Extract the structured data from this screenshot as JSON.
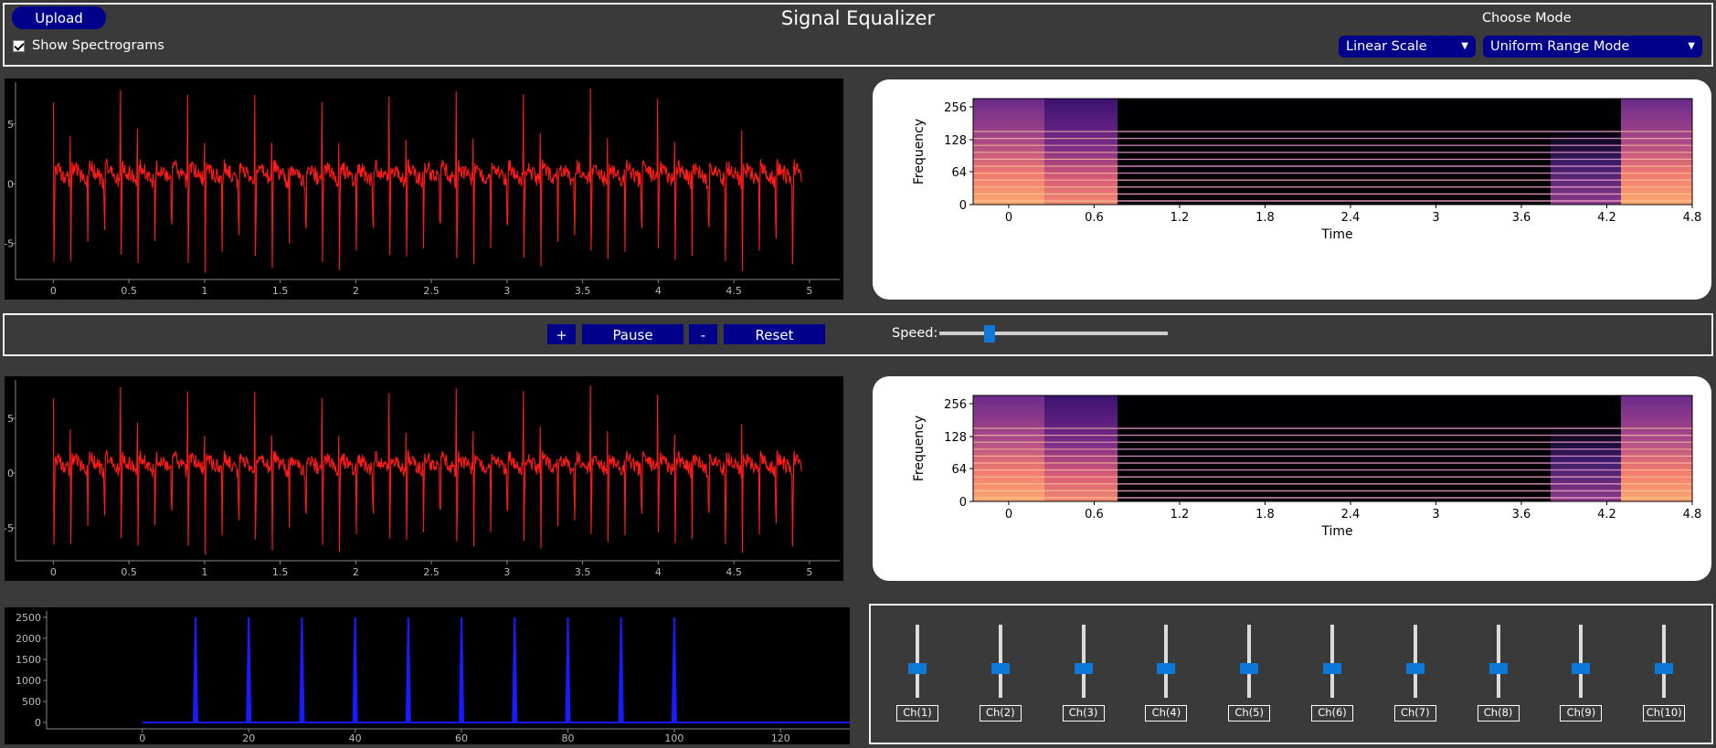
{
  "header": {
    "upload_label": "Upload",
    "title": "Signal Equalizer",
    "show_spectrograms_label": "Show Spectrograms",
    "show_spectrograms_checked": true,
    "choose_mode_label": "Choose Mode",
    "scale_select_value": "Linear Scale",
    "mode_select_value": "Uniform Range Mode"
  },
  "controls": {
    "plus_label": "+",
    "pause_label": "Pause",
    "minus_label": "-",
    "reset_label": "Reset",
    "speed_label": "Speed:",
    "speed_value_fraction": 0.22
  },
  "colors": {
    "accent_button": "#00008b",
    "slider_handle": "#0c78d8",
    "waveform": "#ff1a1a",
    "frequency_trace": "#1a1aff",
    "background": "#3a3a3a"
  },
  "equalizer": {
    "channels": [
      {
        "label": "Ch(1)",
        "level": 0.5
      },
      {
        "label": "Ch(2)",
        "level": 0.5
      },
      {
        "label": "Ch(3)",
        "level": 0.5
      },
      {
        "label": "Ch(4)",
        "level": 0.5
      },
      {
        "label": "Ch(5)",
        "level": 0.5
      },
      {
        "label": "Ch(6)",
        "level": 0.5
      },
      {
        "label": "Ch(7)",
        "level": 0.5
      },
      {
        "label": "Ch(8)",
        "level": 0.5
      },
      {
        "label": "Ch(9)",
        "level": 0.5
      },
      {
        "label": "Ch(10)",
        "level": 0.5
      }
    ]
  },
  "chart_data": [
    {
      "id": "input-waveform",
      "type": "line",
      "x_ticks": [
        "0",
        "0.5",
        "1",
        "1.5",
        "2",
        "2.5",
        "3",
        "3.5",
        "4",
        "4.5",
        "5"
      ],
      "y_ticks": [
        "5",
        "0",
        "-5"
      ],
      "xlim": [
        -0.25,
        5.2
      ],
      "ylim": [
        -8,
        8.5
      ],
      "series": [
        {
          "x_start": 0.0,
          "x_end": 4.95,
          "spike_period": 0.111,
          "min": -7.5,
          "max": 7.5
        }
      ],
      "color": "#ff1a1a"
    },
    {
      "id": "input-spectrogram",
      "type": "heatmap",
      "title": "",
      "xlabel": "Time",
      "ylabel": "Frequency",
      "x_ticks": [
        "0",
        "0.6",
        "1.2",
        "1.8",
        "2.4",
        "3",
        "3.6",
        "4.2",
        "4.8"
      ],
      "y_ticks": [
        "0",
        "64",
        "128",
        "256"
      ],
      "xlim": [
        -0.25,
        4.8
      ],
      "ylim": [
        0,
        400
      ]
    },
    {
      "id": "output-waveform",
      "type": "line",
      "x_ticks": [
        "0",
        "0.5",
        "1",
        "1.5",
        "2",
        "2.5",
        "3",
        "3.5",
        "4",
        "4.5",
        "5"
      ],
      "y_ticks": [
        "5",
        "0",
        "-5"
      ],
      "xlim": [
        -0.25,
        5.2
      ],
      "ylim": [
        -8,
        8.5
      ],
      "series": [
        {
          "x_start": 0.0,
          "x_end": 4.95,
          "spike_period": 0.111,
          "min": -7.5,
          "max": 7.5
        }
      ],
      "color": "#ff1a1a"
    },
    {
      "id": "output-spectrogram",
      "type": "heatmap",
      "title": "",
      "xlabel": "Time",
      "ylabel": "Frequency",
      "x_ticks": [
        "0",
        "0.6",
        "1.2",
        "1.8",
        "2.4",
        "3",
        "3.6",
        "4.2",
        "4.8"
      ],
      "y_ticks": [
        "0",
        "64",
        "128",
        "256"
      ],
      "xlim": [
        -0.25,
        4.8
      ],
      "ylim": [
        0,
        400
      ]
    },
    {
      "id": "frequency-domain",
      "type": "line",
      "x_ticks": [
        "0",
        "20",
        "40",
        "60",
        "80",
        "100",
        "120"
      ],
      "y_ticks": [
        "2500",
        "2000",
        "1500",
        "1000",
        "500",
        "0"
      ],
      "xlim": [
        -18,
        133
      ],
      "ylim": [
        -150,
        2650
      ],
      "series": [
        {
          "name": "",
          "peaks_x": [
            10,
            20,
            30,
            40,
            50,
            60,
            70,
            80,
            90,
            100
          ],
          "peak_y": 2500,
          "baseline_x": [
            0,
            133
          ]
        }
      ],
      "color": "#1a1aff"
    }
  ]
}
